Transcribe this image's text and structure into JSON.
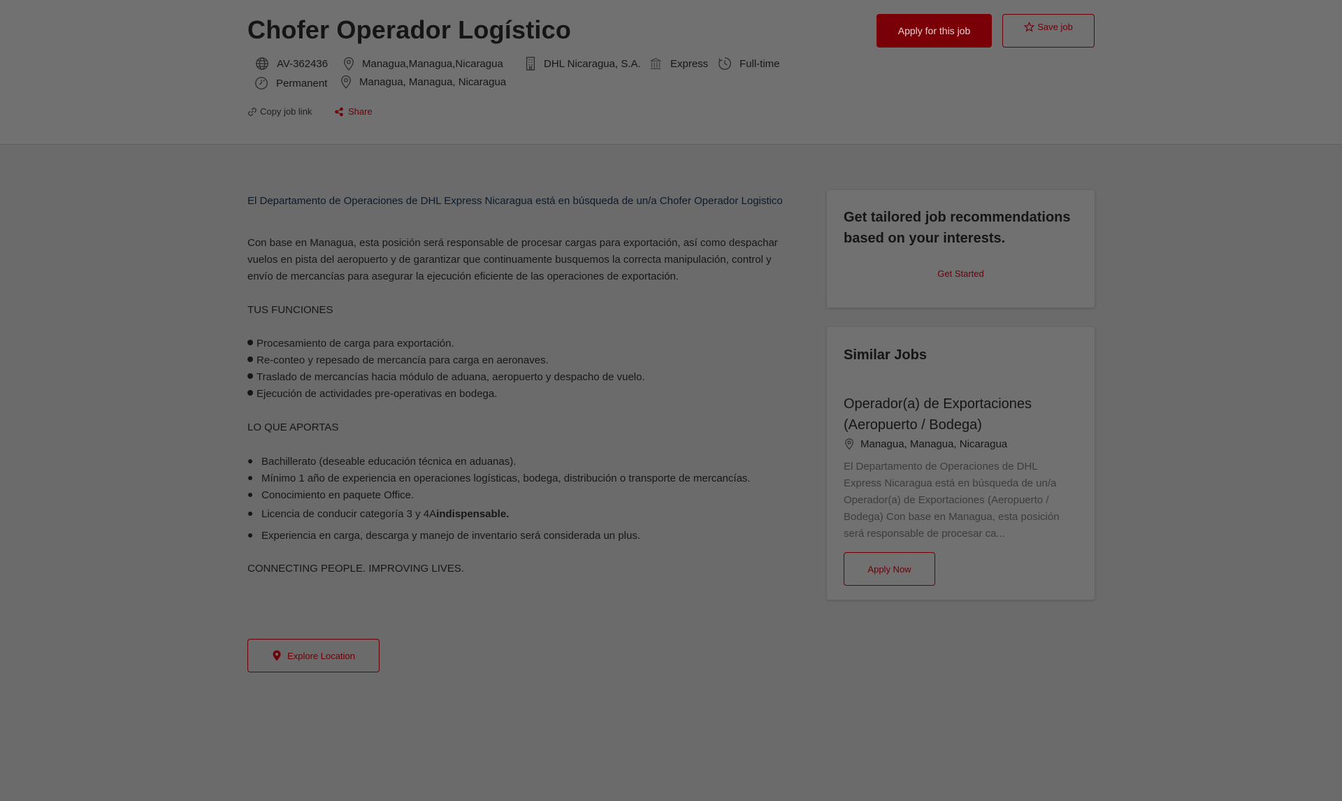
{
  "job": {
    "title": "Chofer Operador Logístico",
    "meta": {
      "job_id": "AV-362436",
      "location_short": "Managua,Managua,Nicaragua",
      "company": "DHL Nicaragua, S.A.",
      "division": "Express",
      "schedule": "Full-time",
      "contract": "Permanent",
      "location_full": "Managua, Managua, Nicaragua"
    },
    "links": {
      "copy": "Copy job link",
      "share": "Share"
    },
    "buttons": {
      "apply": "Apply for this job",
      "save": "Save job"
    }
  },
  "description": {
    "intro": "El Departamento de Operaciones de DHL Express Nicaragua está en búsqueda de un/a Chofer Operador Logistico",
    "paragraph": "Con base en Managua, esta posición será responsable de procesar cargas para exportación, así como despachar vuelos en pista del aeropuerto y de garantizar que continuamente busquemos la correcta manipulación, control y envío de mercancías para asegurar la ejecución eficiente de las operaciones de exportación.",
    "functions_heading": "TUS FUNCIONES",
    "functions": [
      "Procesamiento de carga para exportación.",
      "Re-conteo y repesado de mercancía para carga en aeronaves.",
      "Traslado de mercancías hacia módulo de aduana, aeropuerto y despacho de vuelo.",
      "Ejecución de actividades pre-operativas en bodega."
    ],
    "requirements_heading": "LO QUE APORTAS",
    "requirements": [
      "Bachillerato (deseable educación técnica en aduanas).",
      "Mínimo 1 año de experiencia en operaciones logísticas, bodega, distribución o transporte de mercancías.",
      "Conocimiento en paquete Office."
    ],
    "license_prefix": "Licencia de conducir categoría 3 y 4A",
    "license_bold": "indispensable.",
    "experience": "Experiencia en carga, descarga y manejo de inventario será considerada un plus.",
    "slogan": "CONNECTING PEOPLE. IMPROVING LIVES.",
    "explore_button": "Explore Location"
  },
  "sidebar": {
    "recommend": {
      "title": "Get tailored job recommendations based on your interests.",
      "link": "Get Started"
    },
    "similar": {
      "heading": "Similar Jobs",
      "job_title": "Operador(a) de Exportaciones (Aeropuerto / Bodega)",
      "location": "Managua, Managua, Nicaragua",
      "snippet": "El Departamento de Operaciones de DHL Express Nicaragua está en búsqueda de un/a Operador(a) de Exportaciones (Aeropuerto / Bodega) Con base en Managua, esta posición será responsable de procesar ca...",
      "button": "Apply Now"
    }
  },
  "colors": {
    "accent": "#7a0008",
    "overlay_bg": "#6b6b6b"
  }
}
